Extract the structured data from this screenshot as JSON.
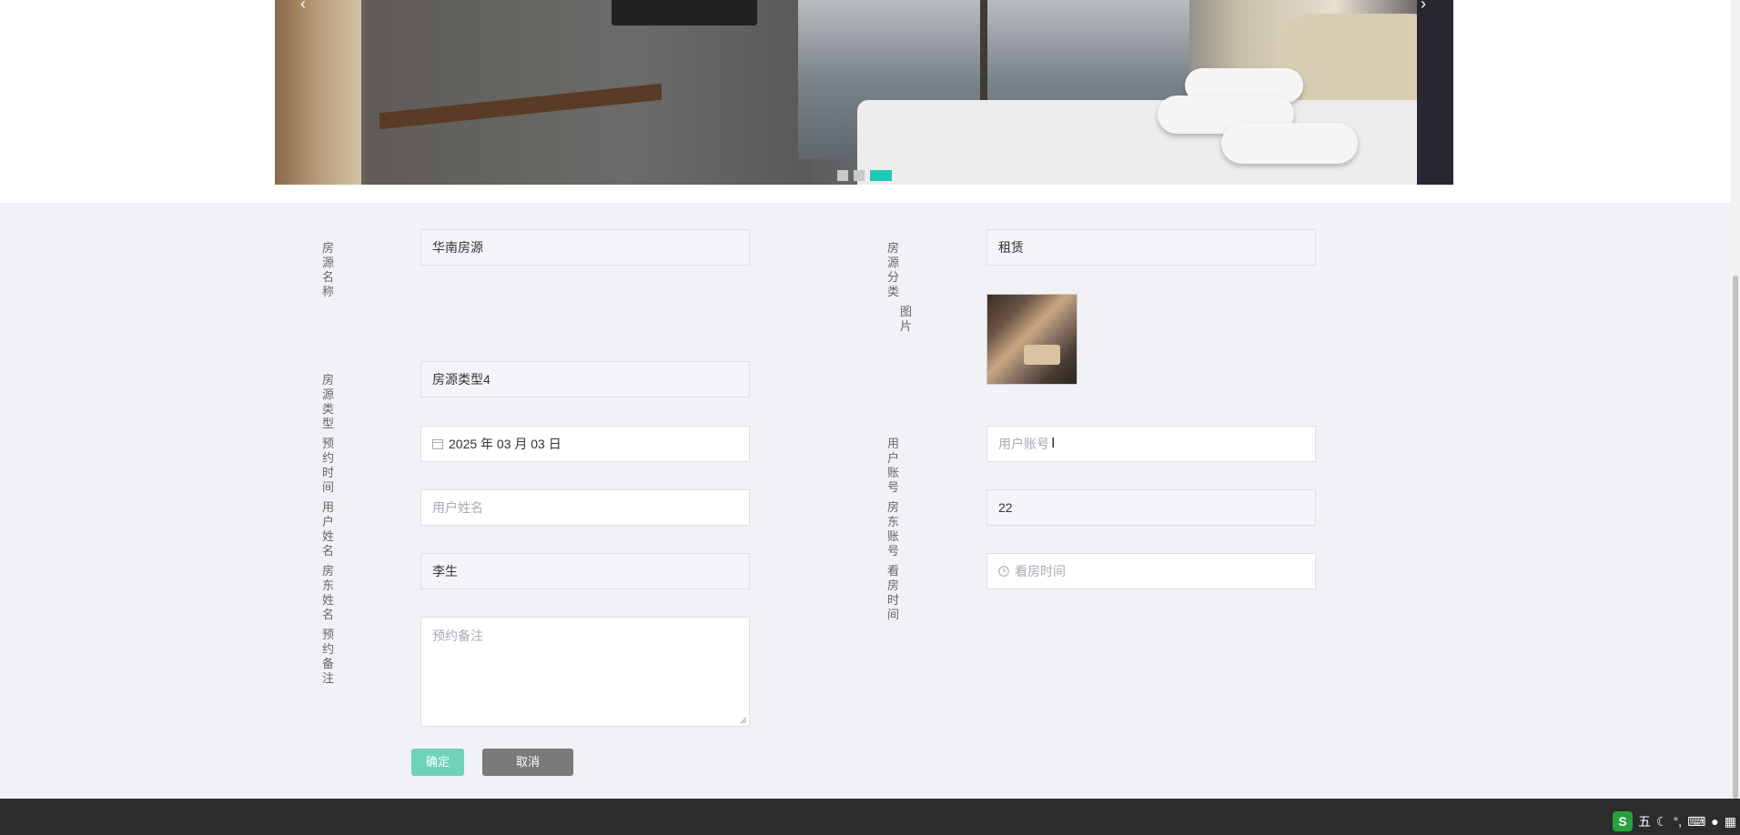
{
  "banner": {
    "prev_arrow": "‹",
    "next_arrow": "›",
    "slides": 3,
    "active_slide": 3
  },
  "form": {
    "house_name": {
      "label": "房源名称",
      "value": "华南房源"
    },
    "house_category": {
      "label": "房源分类",
      "value": "租赁"
    },
    "picture": {
      "label": "图片"
    },
    "house_type": {
      "label": "房源类型",
      "value": "房源类型4"
    },
    "booking_time": {
      "label": "预约时间",
      "value": "2025 年 03 月 03 日"
    },
    "user_account": {
      "label": "用户账号",
      "placeholder": "用户账号"
    },
    "user_name": {
      "label": "用户姓名",
      "placeholder": "用户姓名"
    },
    "landlord_account": {
      "label": "房东账号",
      "value": "22"
    },
    "landlord_name": {
      "label": "房东姓名",
      "value": "李生"
    },
    "viewing_time": {
      "label": "看房时间",
      "placeholder": "看房时间"
    },
    "booking_note": {
      "label": "预约备注",
      "placeholder": "预约备注"
    },
    "confirm_label": "确定",
    "cancel_label": "取消"
  },
  "tray": {
    "ime_logo": "S",
    "ime_mode": "五"
  },
  "colors": {
    "accent": "#23c7b6",
    "confirm": "#6fd4b7",
    "cancel": "#7a7a7a",
    "footer": "#2c2c2c"
  }
}
